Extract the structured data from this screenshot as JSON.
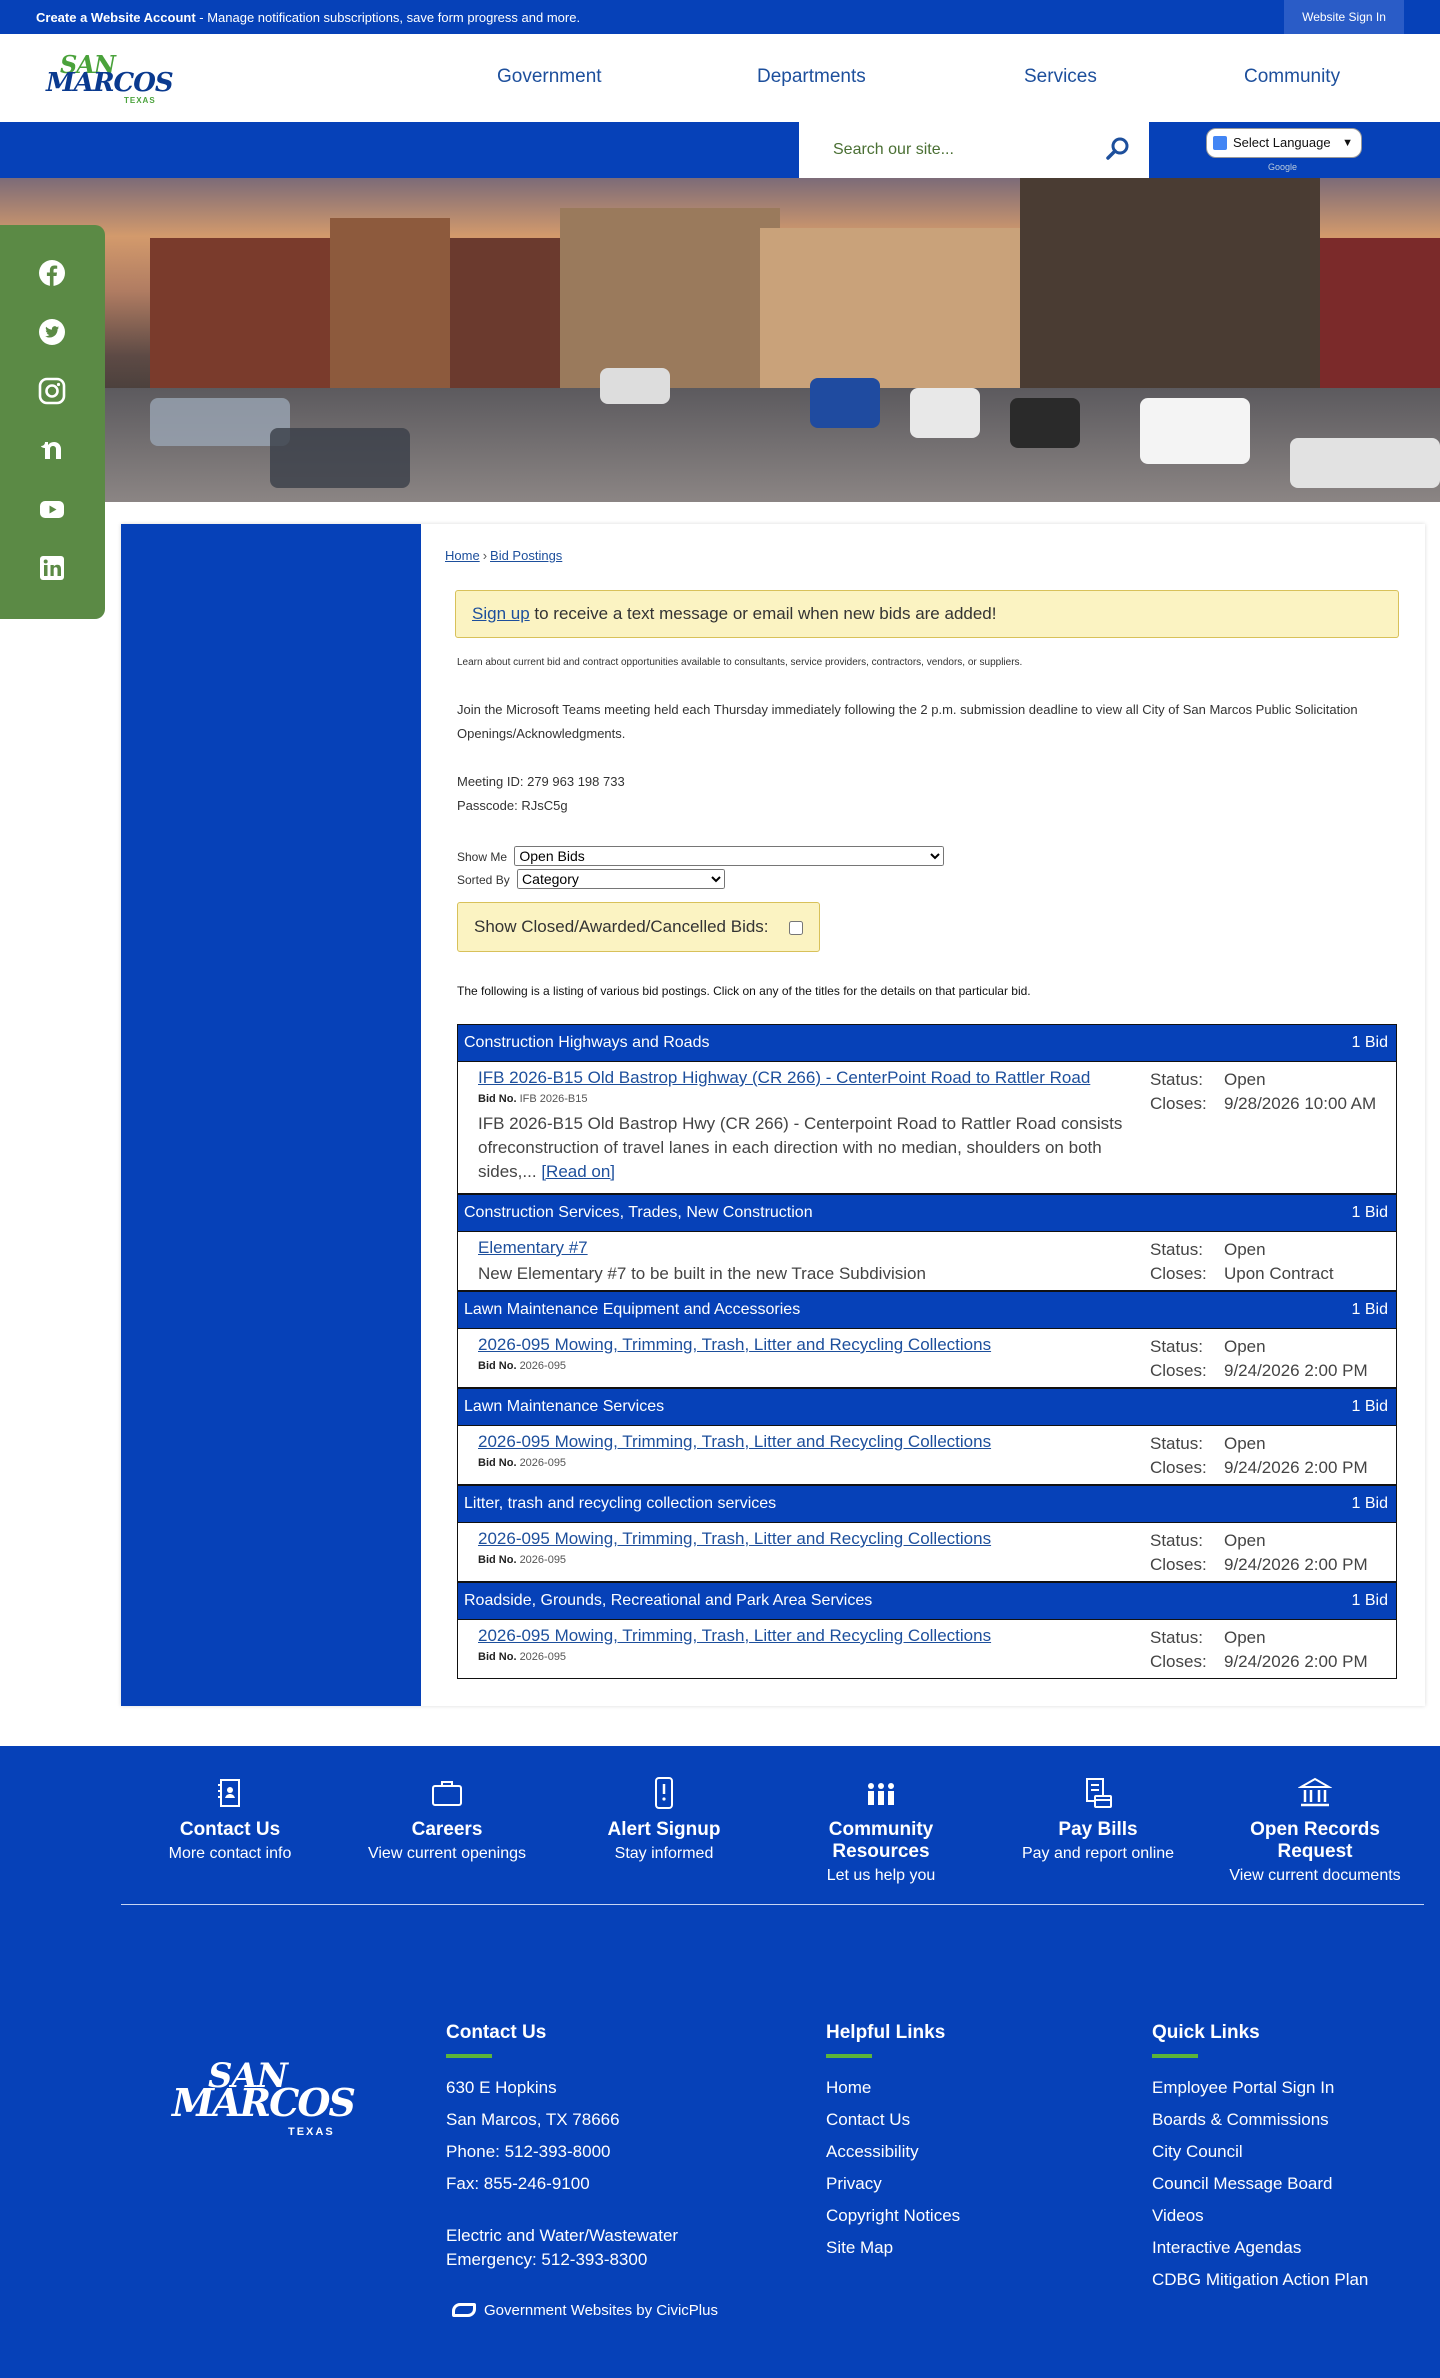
{
  "topbar": {
    "create_account": "Create a Website Account",
    "create_account_desc": " - Manage notification subscriptions, save form progress and more.",
    "sign_in": "Website Sign In"
  },
  "logo": {
    "line1": "SAN",
    "line2": "MARCOS",
    "line3": "TEXAS"
  },
  "nav": {
    "items": [
      "Government",
      "Departments",
      "Services",
      "Community"
    ]
  },
  "search": {
    "placeholder": "Search our site...",
    "icon": "search-icon"
  },
  "translate": {
    "label": "Select Language",
    "powered_by": "Google"
  },
  "social": {
    "icons": [
      "facebook-icon",
      "twitter-icon",
      "instagram-icon",
      "nextdoor-icon",
      "youtube-icon",
      "linkedin-icon"
    ]
  },
  "breadcrumb": {
    "home": "Home",
    "sep": "›",
    "current": "Bid Postings"
  },
  "signup_box": {
    "link": "Sign up",
    "text": " to receive a text message or email when new bids are added!"
  },
  "intro": "Learn about current bid and contract opportunities available to consultants, service providers, contractors, vendors, or suppliers.",
  "teams": "Join the Microsoft Teams meeting held each Thursday immediately following the 2 p.m. submission deadline to view all City of San Marcos Public Solicitation Openings/Acknowledgments.",
  "meeting_id": "Meeting ID: 279 963 198 733",
  "passcode": "Passcode: RJsC5g",
  "filters": {
    "show_me_label": "Show Me",
    "show_me_value": "Open Bids",
    "sorted_by_label": "Sorted By",
    "sorted_by_value": "Category"
  },
  "closed_box": {
    "label": "Show Closed/Awarded/Cancelled Bids:"
  },
  "listing_note": "The following is a listing of various bid postings. Click on any of the titles for the details on that particular bid.",
  "categories": [
    {
      "name": "Construction Highways and Roads",
      "count": "1 Bid",
      "bid": {
        "title": "IFB 2026-B15 Old Bastrop Highway (CR 266) - CenterPoint Road to Rattler Road",
        "bid_no_label": "Bid No.",
        "bid_no": "IFB 2026-B15",
        "desc": "IFB 2026-B15 Old Bastrop Hwy (CR 266) - Centerpoint Road to Rattler Road consists ofreconstruction of travel lanes in each direction with no median, shoulders on both sides,... ",
        "read_on": "[Read on]",
        "status_label": "Status:",
        "status": "Open",
        "closes_label": "Closes:",
        "closes": "9/28/2026 10:00 AM"
      }
    },
    {
      "name": "Construction Services, Trades, New Construction",
      "count": "1 Bid",
      "bid": {
        "title": "Elementary #7",
        "desc": "New Elementary #7  to be built in the new Trace Subdivision",
        "status_label": "Status:",
        "status": "Open",
        "closes_label": "Closes:",
        "closes": "Upon Contract"
      }
    },
    {
      "name": "Lawn Maintenance Equipment and Accessories",
      "count": "1 Bid",
      "bid": {
        "title": "2026-095 Mowing, Trimming, Trash, Litter and Recycling Collections",
        "bid_no_label": "Bid No.",
        "bid_no": "2026-095",
        "status_label": "Status:",
        "status": "Open",
        "closes_label": "Closes:",
        "closes": "9/24/2026 2:00 PM"
      }
    },
    {
      "name": "Lawn Maintenance Services",
      "count": "1 Bid",
      "bid": {
        "title": "2026-095 Mowing, Trimming, Trash, Litter and Recycling Collections",
        "bid_no_label": "Bid No.",
        "bid_no": "2026-095",
        "status_label": "Status:",
        "status": "Open",
        "closes_label": "Closes:",
        "closes": "9/24/2026 2:00 PM"
      }
    },
    {
      "name": "Litter, trash and recycling collection services",
      "count": "1 Bid",
      "bid": {
        "title": "2026-095 Mowing, Trimming, Trash, Litter and Recycling Collections",
        "bid_no_label": "Bid No.",
        "bid_no": "2026-095",
        "status_label": "Status:",
        "status": "Open",
        "closes_label": "Closes:",
        "closes": "9/24/2026 2:00 PM"
      }
    },
    {
      "name": "Roadside, Grounds, Recreational and Park Area Services",
      "count": "1 Bid",
      "bid": {
        "title": "2026-095 Mowing, Trimming, Trash, Litter and Recycling Collections",
        "bid_no_label": "Bid No.",
        "bid_no": "2026-095",
        "status_label": "Status:",
        "status": "Open",
        "closes_label": "Closes:",
        "closes": "9/24/2026 2:00 PM"
      }
    }
  ],
  "quick_icons": [
    {
      "title": "Contact Us",
      "sub": "More contact info",
      "icon": "contact-card-icon"
    },
    {
      "title": "Careers",
      "sub": "View current openings",
      "icon": "briefcase-icon"
    },
    {
      "title": "Alert Signup",
      "sub": "Stay informed",
      "icon": "phone-alert-icon"
    },
    {
      "title": "Community Resources",
      "sub": "Let us help you",
      "icon": "people-icon"
    },
    {
      "title": "Pay Bills",
      "sub": "Pay and report online",
      "icon": "bill-icon"
    },
    {
      "title": "Open Records Request",
      "sub": "View current documents",
      "icon": "courthouse-icon"
    }
  ],
  "footer": {
    "contact": {
      "heading": "Contact Us",
      "address1": "630 E Hopkins",
      "address2": "San Marcos, TX 78666",
      "phone": "Phone: 512-393-8000",
      "fax": "Fax: 855-246-9100",
      "emergency1": "Electric and Water/Wastewater",
      "emergency2": "Emergency: 512-393-8300"
    },
    "helpful": {
      "heading": "Helpful Links",
      "items": [
        "Home",
        "Contact Us",
        "Accessibility",
        "Privacy",
        "Copyright Notices",
        "Site Map"
      ]
    },
    "quick": {
      "heading": "Quick Links",
      "items": [
        "Employee Portal Sign In",
        "Boards & Commissions",
        "City Council",
        "Council Message Board",
        "Videos",
        "Interactive Agendas",
        "CDBG Mitigation Action Plan"
      ]
    },
    "civicplus": "Government Websites by CivicPlus"
  },
  "colors": {
    "brand_blue": "#0641b8",
    "brand_green": "#5b8a45",
    "notice_yellow": "#fbf3c2"
  }
}
